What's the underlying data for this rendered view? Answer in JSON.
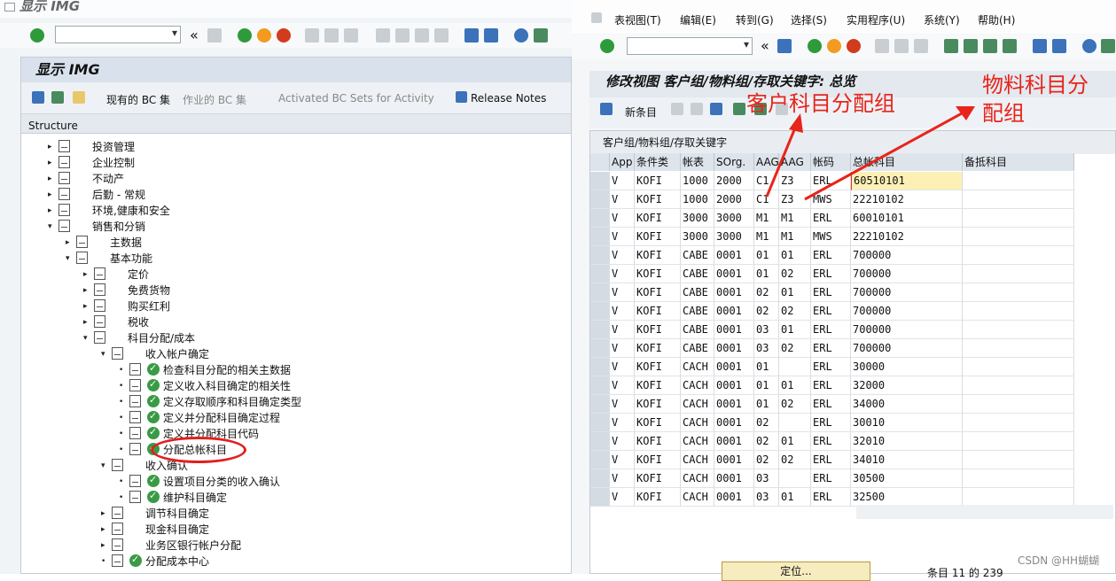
{
  "left": {
    "window_title": "显示 IMG",
    "panel_title": "显示 IMG",
    "toolbar": {
      "current_bc": "现有的 BC 集",
      "active_bc": "作业的 BC 集",
      "activated_bc": "Activated BC Sets for Activity",
      "release_notes": "Release Notes"
    },
    "structure_label": "Structure",
    "tree": [
      {
        "level": 1,
        "label": "投资管理",
        "exp": "right"
      },
      {
        "level": 1,
        "label": "企业控制",
        "exp": "right"
      },
      {
        "level": 1,
        "label": "不动产",
        "exp": "right"
      },
      {
        "level": 1,
        "label": "后勤 - 常规",
        "exp": "right"
      },
      {
        "level": 1,
        "label": "环境,健康和安全",
        "exp": "right"
      },
      {
        "level": 1,
        "label": "销售和分销",
        "exp": "down"
      },
      {
        "level": 2,
        "label": "主数据",
        "exp": "right"
      },
      {
        "level": 2,
        "label": "基本功能",
        "exp": "down"
      },
      {
        "level": 3,
        "label": "定价",
        "exp": "right"
      },
      {
        "level": 3,
        "label": "免费货物",
        "exp": "right"
      },
      {
        "level": 3,
        "label": "购买红利",
        "exp": "right"
      },
      {
        "level": 3,
        "label": "税收",
        "exp": "right"
      },
      {
        "level": 3,
        "label": "科目分配/成本",
        "exp": "down"
      },
      {
        "level": 4,
        "label": "收入帐户确定",
        "exp": "down"
      },
      {
        "level": 5,
        "label": "检查科目分配的相关主数据",
        "exp": "dot"
      },
      {
        "level": 5,
        "label": "定义收入科目确定的相关性",
        "exp": "dot"
      },
      {
        "level": 5,
        "label": "定义存取顺序和科目确定类型",
        "exp": "dot"
      },
      {
        "level": 5,
        "label": "定义并分配科目确定过程",
        "exp": "dot"
      },
      {
        "level": 5,
        "label": "定义并分配科目代码",
        "exp": "dot"
      },
      {
        "level": 5,
        "label": "分配总帐科目",
        "exp": "dot"
      },
      {
        "level": 4,
        "label": "收入确认",
        "exp": "down"
      },
      {
        "level": 5,
        "label": "设置项目分类的收入确认",
        "exp": "dot"
      },
      {
        "level": 5,
        "label": "维护科目确定",
        "exp": "dot"
      },
      {
        "level": 4,
        "label": "调节科目确定",
        "exp": "right"
      },
      {
        "level": 4,
        "label": "现金科目确定",
        "exp": "right"
      },
      {
        "level": 4,
        "label": "业务区银行帐户分配",
        "exp": "right"
      },
      {
        "level": 4,
        "label": "分配成本中心",
        "exp": "dot"
      }
    ]
  },
  "right": {
    "menu": [
      "表视图(T)",
      "编辑(E)",
      "转到(G)",
      "选择(S)",
      "实用程序(U)",
      "系统(Y)",
      "帮助(H)"
    ],
    "title": "修改视图 客户组/物料组/存取关键字: 总览",
    "new_entry": "新条目",
    "table_title": "客户组/物料组/存取关键字",
    "columns": [
      "App",
      "条件类",
      "帐表",
      "SOrg.",
      "AAG",
      "AAG",
      "帐码",
      "总帐科目",
      "备抵科目"
    ],
    "rows": [
      [
        "V",
        "KOFI",
        "1000",
        "2000",
        "C1",
        "Z3",
        "ERL",
        "60510101",
        ""
      ],
      [
        "V",
        "KOFI",
        "1000",
        "2000",
        "C1",
        "Z3",
        "MWS",
        "22210102",
        ""
      ],
      [
        "V",
        "KOFI",
        "3000",
        "3000",
        "M1",
        "M1",
        "ERL",
        "60010101",
        ""
      ],
      [
        "V",
        "KOFI",
        "3000",
        "3000",
        "M1",
        "M1",
        "MWS",
        "22210102",
        ""
      ],
      [
        "V",
        "KOFI",
        "CABE",
        "0001",
        "01",
        "01",
        "ERL",
        "700000",
        ""
      ],
      [
        "V",
        "KOFI",
        "CABE",
        "0001",
        "01",
        "02",
        "ERL",
        "700000",
        ""
      ],
      [
        "V",
        "KOFI",
        "CABE",
        "0001",
        "02",
        "01",
        "ERL",
        "700000",
        ""
      ],
      [
        "V",
        "KOFI",
        "CABE",
        "0001",
        "02",
        "02",
        "ERL",
        "700000",
        ""
      ],
      [
        "V",
        "KOFI",
        "CABE",
        "0001",
        "03",
        "01",
        "ERL",
        "700000",
        ""
      ],
      [
        "V",
        "KOFI",
        "CABE",
        "0001",
        "03",
        "02",
        "ERL",
        "700000",
        ""
      ],
      [
        "V",
        "KOFI",
        "CACH",
        "0001",
        "01",
        "",
        "ERL",
        "30000",
        ""
      ],
      [
        "V",
        "KOFI",
        "CACH",
        "0001",
        "01",
        "01",
        "ERL",
        "32000",
        ""
      ],
      [
        "V",
        "KOFI",
        "CACH",
        "0001",
        "01",
        "02",
        "ERL",
        "34000",
        ""
      ],
      [
        "V",
        "KOFI",
        "CACH",
        "0001",
        "02",
        "",
        "ERL",
        "30010",
        ""
      ],
      [
        "V",
        "KOFI",
        "CACH",
        "0001",
        "02",
        "01",
        "ERL",
        "32010",
        ""
      ],
      [
        "V",
        "KOFI",
        "CACH",
        "0001",
        "02",
        "02",
        "ERL",
        "34010",
        ""
      ],
      [
        "V",
        "KOFI",
        "CACH",
        "0001",
        "03",
        "",
        "ERL",
        "30500",
        ""
      ],
      [
        "V",
        "KOFI",
        "CACH",
        "0001",
        "03",
        "01",
        "ERL",
        "32500",
        ""
      ]
    ],
    "position_button": "定位...",
    "entry_info": "条目 11 的 239"
  },
  "annotations": {
    "customer_group": "客户科目分配组",
    "material_group_line1": "物料科目分",
    "material_group_line2": "配组",
    "color": "#e8241b"
  },
  "watermark": "CSDN @HH蝴蝴"
}
